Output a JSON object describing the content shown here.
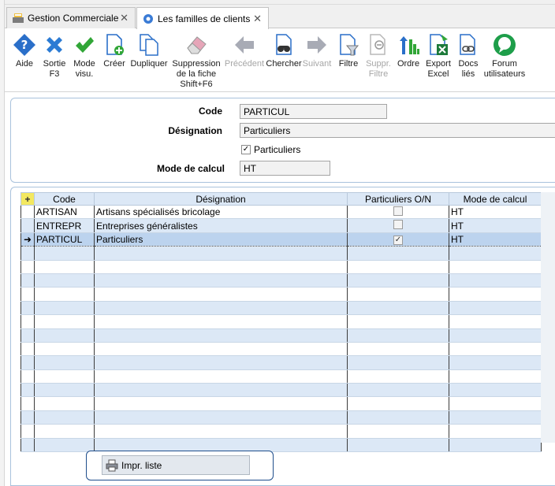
{
  "tabs": [
    {
      "label": "Gestion Commerciale",
      "close": "✕"
    },
    {
      "label": "Les familles de clients",
      "close": "✕"
    }
  ],
  "toolbar": {
    "aide": {
      "label": "Aide",
      "icon": "help-diamond-icon"
    },
    "sortie": {
      "label": "Sortie\nF3",
      "icon": "close-x-icon"
    },
    "mode_visu": {
      "label": "Mode\nvisu.",
      "icon": "checkmark-icon"
    },
    "creer": {
      "label": "Créer",
      "icon": "new-document-icon"
    },
    "dupliquer": {
      "label": "Dupliquer",
      "icon": "duplicate-icon"
    },
    "suppression": {
      "label": "Suppression\nde la fiche\nShift+F6",
      "icon": "eraser-icon"
    },
    "precedent": {
      "label": "Précédent",
      "icon": "arrow-left-icon"
    },
    "chercher": {
      "label": "Chercher",
      "icon": "binoculars-icon"
    },
    "suivant": {
      "label": "Suivant",
      "icon": "arrow-right-icon"
    },
    "filtre": {
      "label": "Filtre",
      "icon": "filter-icon"
    },
    "suppr_filtre": {
      "label": "Suppr.\nFiltre",
      "icon": "remove-filter-icon"
    },
    "ordre": {
      "label": "Ordre",
      "icon": "sort-icon"
    },
    "export_excel": {
      "label": "Export\nExcel",
      "icon": "excel-icon"
    },
    "docs_lies": {
      "label": "Docs\nliés",
      "icon": "linked-docs-icon"
    },
    "forum": {
      "label": "Forum\nutilisateurs",
      "icon": "forum-icon"
    }
  },
  "form": {
    "code_label": "Code",
    "code_value": "PARTICUL",
    "designation_label": "Désignation",
    "designation_value": "Particuliers",
    "particuliers_checkbox_label": "Particuliers",
    "particuliers_checked": true,
    "mode_calcul_label": "Mode de calcul",
    "mode_calcul_value": "HT"
  },
  "grid": {
    "columns": {
      "add": "+",
      "code": "Code",
      "designation": "Désignation",
      "particuliers": "Particuliers O/N",
      "mode_calcul": "Mode de calcul"
    },
    "rows": [
      {
        "code": "ARTISAN",
        "designation": "Artisans spécialisés bricolage",
        "particuliers": false,
        "mode": "HT"
      },
      {
        "code": "ENTREPR",
        "designation": "Entreprises généralistes",
        "particuliers": false,
        "mode": "HT"
      },
      {
        "code": "PARTICUL",
        "designation": "Particuliers",
        "particuliers": true,
        "mode": "HT",
        "selected": true
      }
    ],
    "selected_marker": "➜",
    "check_mark": "✓"
  },
  "print_button": {
    "label": "Impr. liste",
    "icon": "printer-icon"
  },
  "colors": {
    "accent_blue": "#1f6fc5",
    "green": "#2aa34a",
    "grid_header": "#dce8f6",
    "selected_row": "#bcd3ee"
  }
}
